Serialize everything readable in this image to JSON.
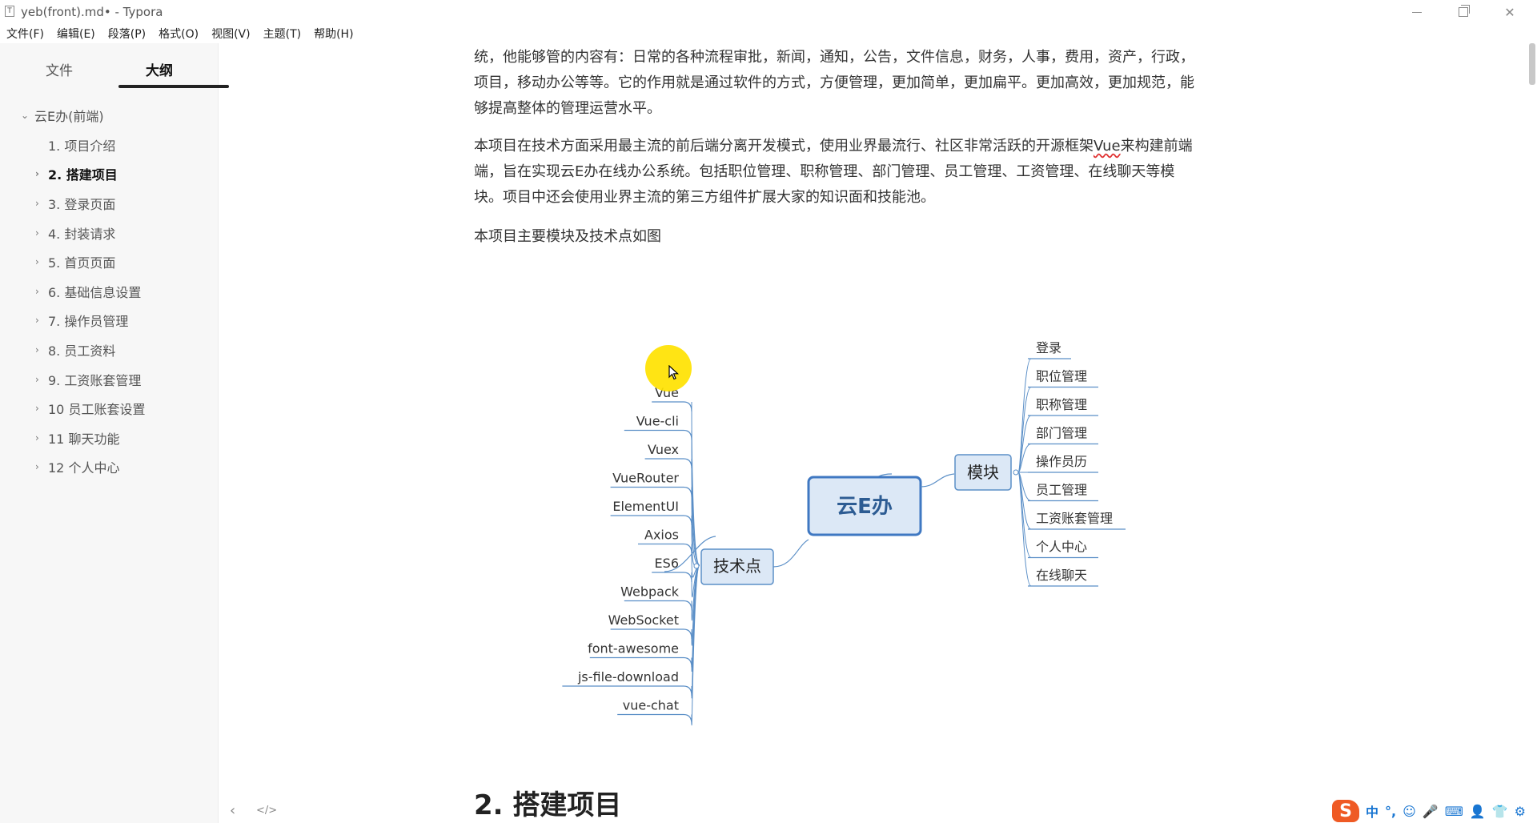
{
  "window": {
    "title": "yeb(front).md• - Typora",
    "icon_glyph": "T"
  },
  "menubar": [
    "文件(F)",
    "编辑(E)",
    "段落(P)",
    "格式(O)",
    "视图(V)",
    "主题(T)",
    "帮助(H)"
  ],
  "sidebar": {
    "tabs": {
      "files": "文件",
      "outline": "大纲"
    },
    "outline": [
      {
        "label": "云E办(前端)",
        "level": "root",
        "caret": "⌄"
      },
      {
        "label": "1. 项目介绍",
        "level": "child",
        "caret": ""
      },
      {
        "label": "2. 搭建项目",
        "level": "child",
        "caret": "›",
        "active": true
      },
      {
        "label": "3. 登录页面",
        "level": "child",
        "caret": "›"
      },
      {
        "label": "4. 封装请求",
        "level": "child",
        "caret": "›"
      },
      {
        "label": "5. 首页页面",
        "level": "child",
        "caret": "›"
      },
      {
        "label": "6. 基础信息设置",
        "level": "child",
        "caret": "›"
      },
      {
        "label": "7. 操作员管理",
        "level": "child",
        "caret": "›"
      },
      {
        "label": "8. 员工资料",
        "level": "child",
        "caret": "›"
      },
      {
        "label": "9. 工资账套管理",
        "level": "child",
        "caret": "›"
      },
      {
        "label": "10 员工账套设置",
        "level": "child",
        "caret": "›"
      },
      {
        "label": "11 聊天功能",
        "level": "child",
        "caret": "›"
      },
      {
        "label": "12 个人中心",
        "level": "child",
        "caret": "›"
      }
    ],
    "footer": {
      "back": "‹",
      "source": "</>"
    }
  },
  "content": {
    "para1_line1": "统，他能够管的内容有：日常的各种流程审批，新闻，通知，公告，文件信息，财务，人事，费用，资产，行政，",
    "para1_line2": "项目，移动办公等等。它的作用就是通过软件的方式，方便管理，更加简单，更加扁平。更加高效，更加规范，能",
    "para1_line3": "够提高整体的管理运营水平。",
    "para2_a": "本项目在技术方面采用最主流的前后端分离开发模式，使用业界最流行、社区非常活跃的开源框架",
    "para2_vue": "Vue",
    "para2_b": "来构建前端",
    "para2_line2": "端，旨在实现云E办在线办公系统。包括职位管理、职称管理、部门管理、员工管理、工资管理、在线聊天等模",
    "para2_line3": "块。项目中还会使用业界主流的第三方组件扩展大家的知识面和技能池。",
    "para3": "本项目主要模块及技术点如图",
    "heading2": "2. 搭建项目"
  },
  "mindmap": {
    "center": "云E办",
    "left_branch": "技术点",
    "right_branch": "模块",
    "tech": [
      "Vue",
      "Vue-cli",
      "Vuex",
      "VueRouter",
      "ElementUI",
      "Axios",
      "ES6",
      "Webpack",
      "WebSocket",
      "font-awesome",
      "js-file-download",
      "vue-chat"
    ],
    "modules": [
      "登录",
      "职位管理",
      "职称管理",
      "部门管理",
      "操作员历",
      "员工管理",
      "工资账套管理",
      "个人中心",
      "在线聊天"
    ]
  },
  "ime": {
    "brand": "S",
    "items": [
      "中",
      "°,",
      "☺",
      "🎤",
      "⌨",
      "👤",
      "👕",
      "⚙"
    ]
  },
  "colors": {
    "node_fill": "#dce8f6",
    "node_border": "#5b8fc7",
    "center_border": "#3f78c2",
    "branch_line": "#5b8fc7",
    "cursor_halo": "#ffe200",
    "sogou": "#ef5a24"
  }
}
